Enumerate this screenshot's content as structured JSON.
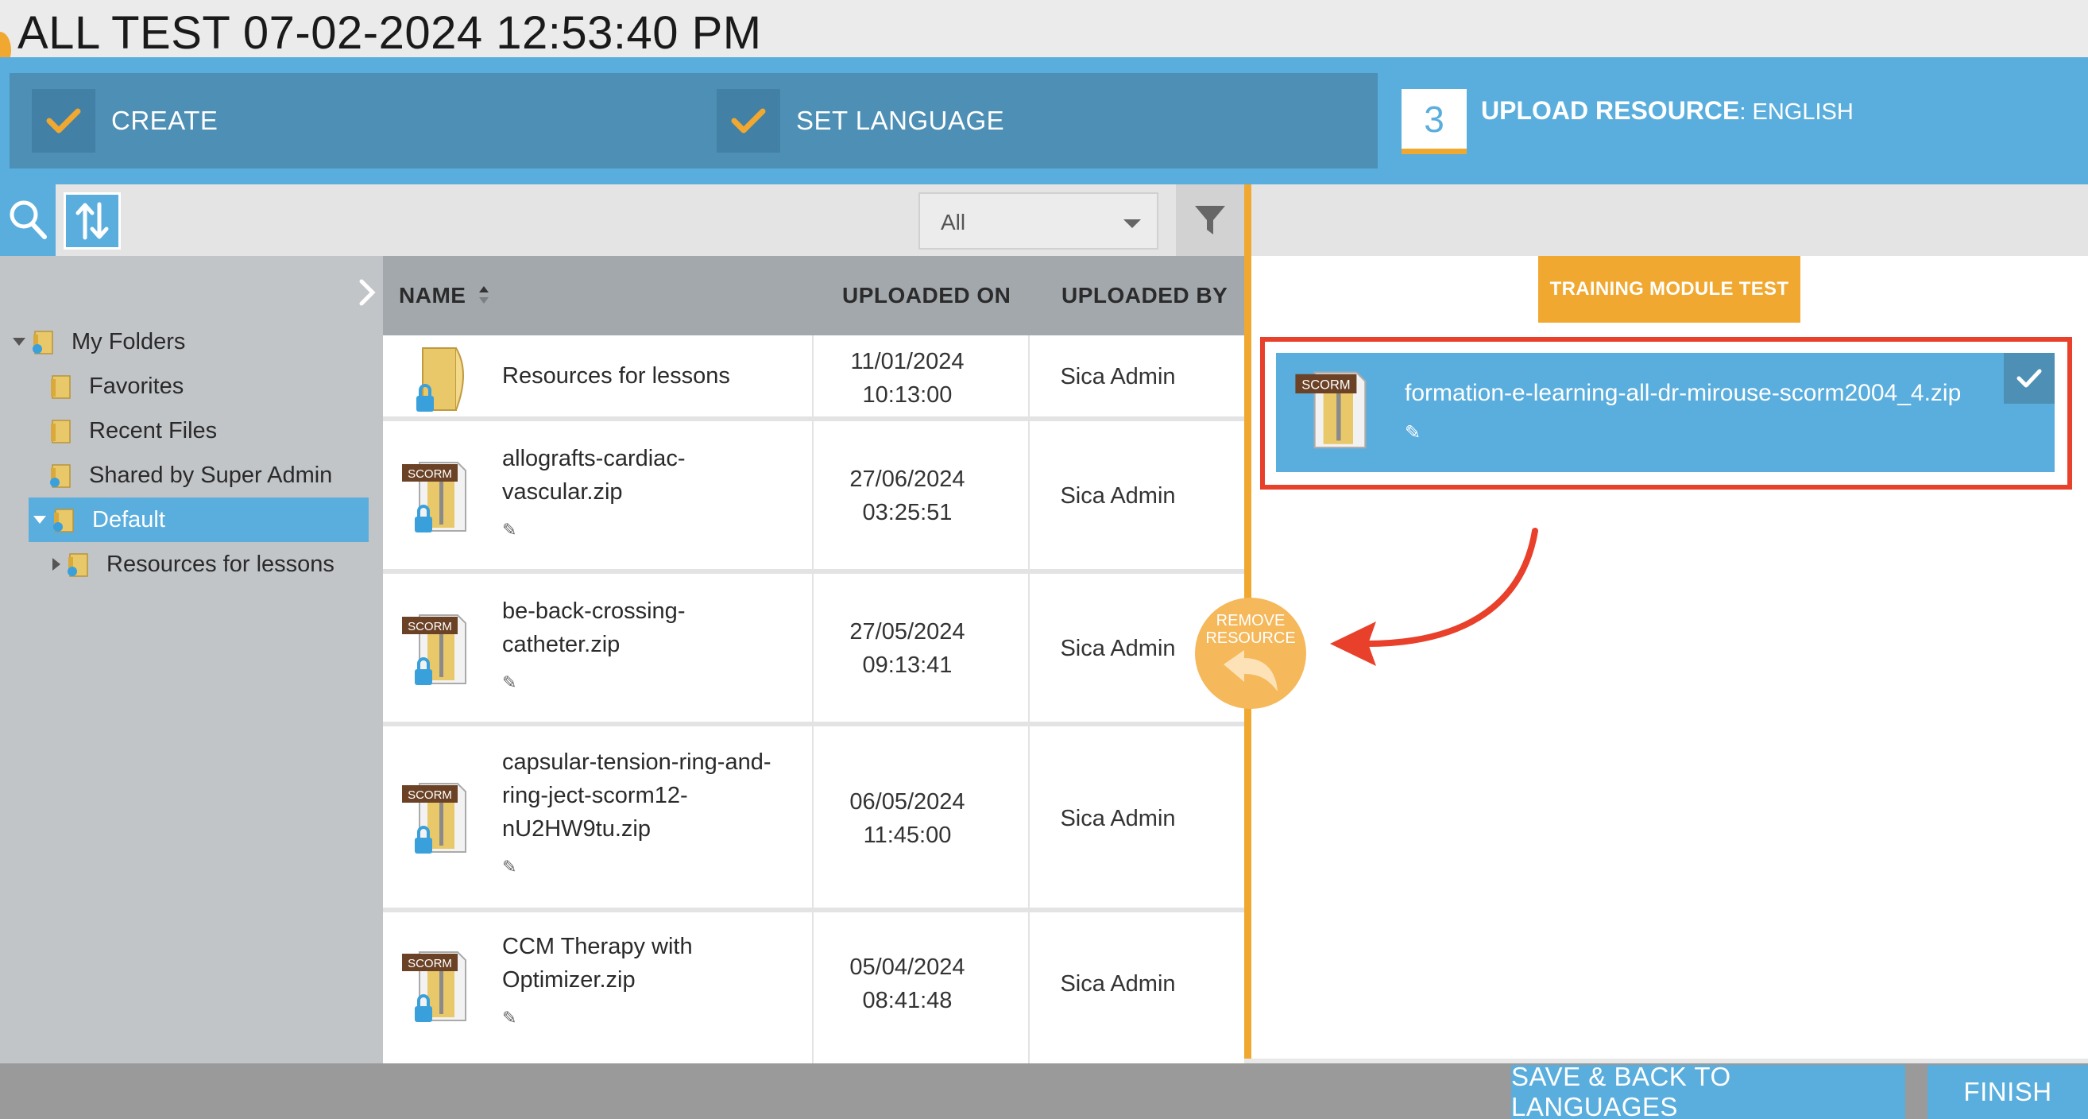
{
  "header": {
    "title": "ALL TEST 07-02-2024 12:53:40 PM"
  },
  "wizard": {
    "steps": [
      {
        "label": "CREATE",
        "state": "done"
      },
      {
        "label": "SET LANGUAGE",
        "state": "done"
      },
      {
        "number": "3",
        "label": "UPLOAD RESOURCE",
        "suffix": ": ENGLISH",
        "state": "current"
      }
    ]
  },
  "toolbar": {
    "filter_value": "All"
  },
  "sidebar": {
    "items": [
      {
        "label": "My Folders",
        "state": "expanded"
      },
      {
        "label": "Favorites"
      },
      {
        "label": "Recent Files"
      },
      {
        "label": "Shared by Super Admin"
      },
      {
        "label": "Default",
        "state": "selected-expanded"
      },
      {
        "label": "Resources for lessons",
        "state": "collapsed"
      }
    ]
  },
  "table": {
    "columns": {
      "name": "NAME",
      "uploaded_on": "UPLOADED ON",
      "uploaded_by": "UPLOADED BY"
    },
    "rows": [
      {
        "type": "folder",
        "name_lines": [
          "Resources for lessons"
        ],
        "date": "11/01/2024",
        "time": "10:13:00",
        "by": "Sica Admin"
      },
      {
        "type": "scorm",
        "name_lines": [
          "allografts-cardiac-",
          "vascular.zip"
        ],
        "date": "27/06/2024",
        "time": "03:25:51",
        "by": "Sica Admin"
      },
      {
        "type": "scorm",
        "name_lines": [
          "be-back-crossing-",
          "catheter.zip"
        ],
        "date": "27/05/2024",
        "time": "09:13:41",
        "by": "Sica Admin"
      },
      {
        "type": "scorm",
        "name_lines": [
          "capsular-tension-ring-and-",
          "ring-ject-scorm12-",
          "nU2HW9tu.zip"
        ],
        "date": "06/05/2024",
        "time": "11:45:00",
        "by": "Sica Admin"
      },
      {
        "type": "scorm",
        "name_lines": [
          "CCM Therapy with",
          "Optimizer.zip"
        ],
        "date": "05/04/2024",
        "time": "08:41:48",
        "by": "Sica Admin"
      }
    ]
  },
  "right_panel": {
    "module_tag": "TRAINING MODULE TEST",
    "selected_resource": {
      "name": "formation-e-learning-all-dr-mirouse-scorm2004_4.zip",
      "badge": "SCORM"
    },
    "remove_label_1": "REMOVE",
    "remove_label_2": "RESOURCE"
  },
  "icons": {
    "scorm_badge": "SCORM"
  },
  "footer": {
    "save_label": "SAVE & BACK TO LANGUAGES",
    "finish_label": "FINISH"
  },
  "colors": {
    "accent_blue": "#5aaedd",
    "accent_orange": "#f0a830",
    "highlight_red": "#e8402a"
  }
}
